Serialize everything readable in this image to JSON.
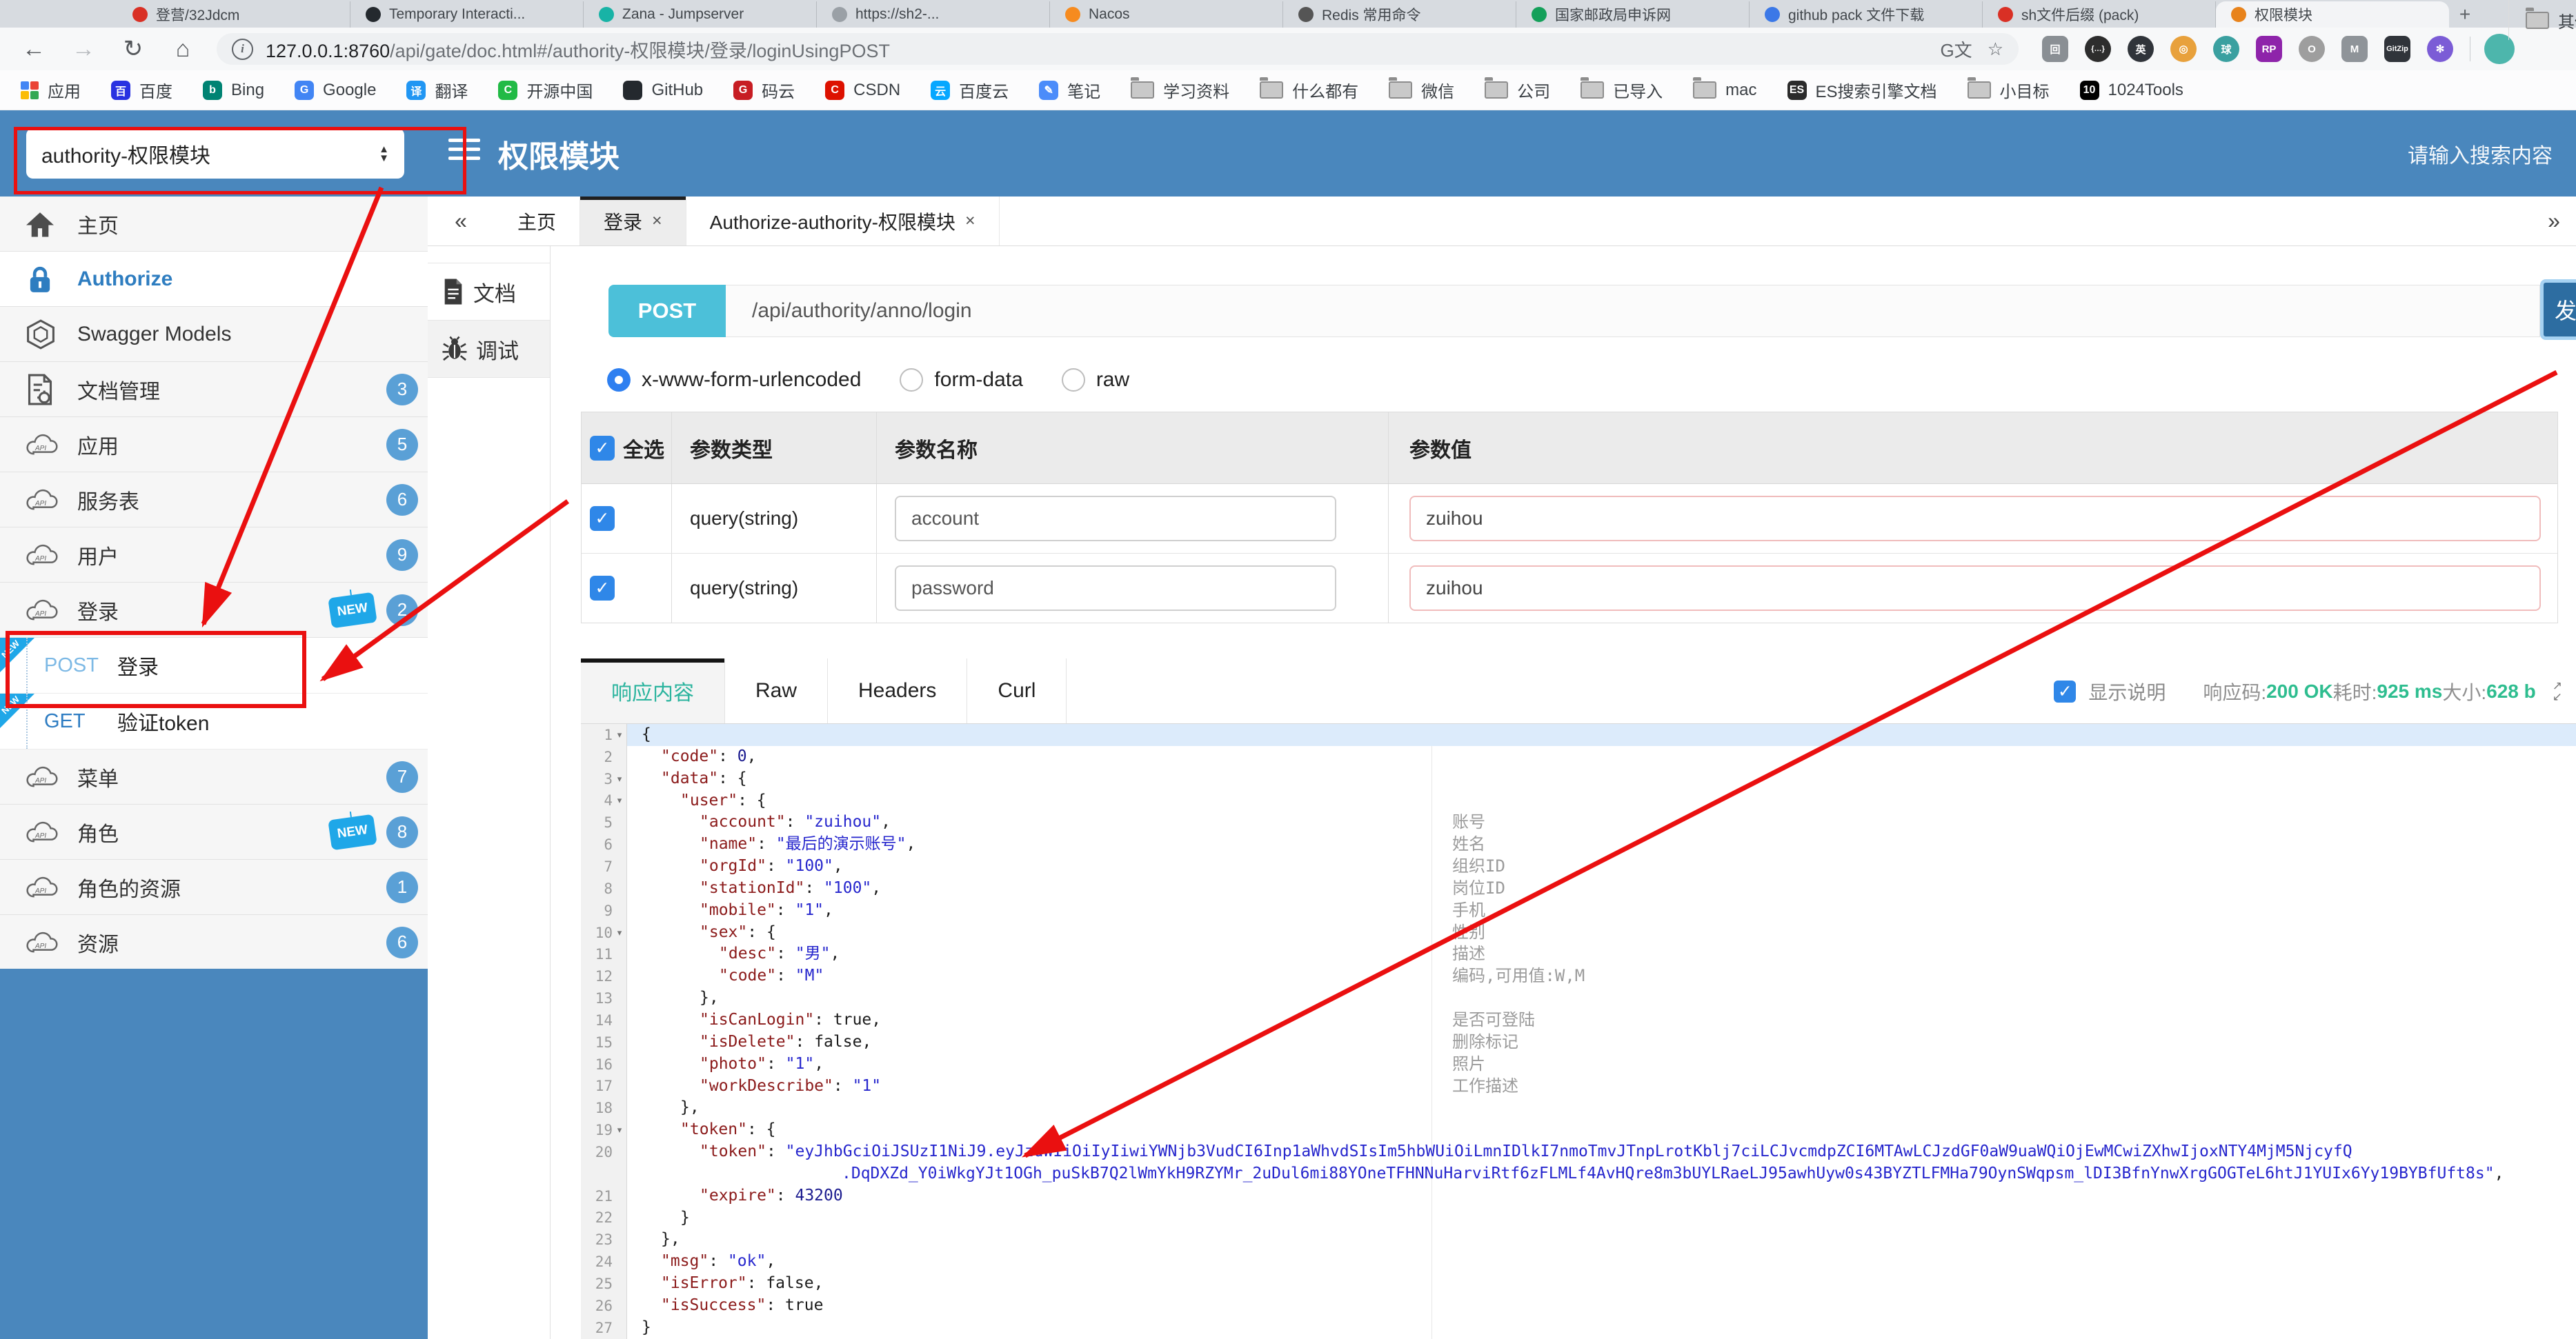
{
  "colors": {
    "header_blue": "#4a87bd",
    "annotation_red": "#ea1010",
    "badge_blue": "#5aa0d6",
    "new_tag_blue": "#1fa7e8",
    "post_chip": "#4cc0d9",
    "send_button": "#2d6da1",
    "response_active_teal": "#2bb49e",
    "status_green": "#2ebd8f",
    "json_key": "#8b1a1a",
    "json_string": "#2626cd",
    "json_number": "#1b1b8f"
  },
  "browser": {
    "tabs": [
      {
        "color": "#d93025",
        "label": "登营/32Jdcm"
      },
      {
        "color": "#24292e",
        "label": "Temporary Interacti..."
      },
      {
        "color": "#18b3a6",
        "label": "Zana - Jumpserver"
      },
      {
        "color": "#9aa0a6",
        "label": "https://sh2-..."
      },
      {
        "color": "#f68b1f",
        "label": "Nacos"
      },
      {
        "color": "#555555",
        "label": "Redis 常用命令"
      },
      {
        "color": "#14a05a",
        "label": "国家邮政局申诉网"
      },
      {
        "color": "#3b78e7",
        "label": "github pack 文件下载"
      },
      {
        "color": "#d93025",
        "label": "sh文件后缀 (pack)"
      },
      {
        "color": "#e8831c",
        "label": "权限模块",
        "active": true
      }
    ],
    "new_tab_glyph": "+",
    "url_host": "127.0.0.1:8760",
    "url_rest": "/api/gate/doc.html#/authority-权限模块/登录/loginUsingPOST",
    "ext_icons": [
      {
        "glyph": "回",
        "color": "#8a8f94",
        "shape": "square"
      },
      {
        "glyph": "{…}",
        "color": "#2d2d2d",
        "shape": "circle"
      },
      {
        "glyph": "英",
        "color": "#30343a",
        "shape": "circle"
      },
      {
        "glyph": "◎",
        "color": "#e8a13c",
        "shape": "circle"
      },
      {
        "glyph": "球",
        "color": "#3aa0a0",
        "shape": "circle"
      },
      {
        "glyph": "RP",
        "color": "#8e24aa",
        "shape": "square"
      },
      {
        "glyph": "O",
        "color": "#9e9e9e",
        "shape": "circle"
      },
      {
        "glyph": "M",
        "color": "#8f9499",
        "shape": "square"
      },
      {
        "glyph": "GitZip",
        "color": "#30343a",
        "shape": "square"
      },
      {
        "glyph": "✻",
        "color": "#7b5cd6",
        "shape": "circle"
      }
    ],
    "bookmarks": [
      {
        "kind": "grid",
        "label": "应用"
      },
      {
        "kind": "site",
        "color": "#2932e1",
        "glyph": "百",
        "label": "百度"
      },
      {
        "kind": "site",
        "color": "#008373",
        "glyph": "b",
        "label": "Bing"
      },
      {
        "kind": "site",
        "color": "#4285f4",
        "glyph": "G",
        "label": "Google"
      },
      {
        "kind": "site",
        "color": "#2196f3",
        "glyph": "译",
        "label": "翻译"
      },
      {
        "kind": "site",
        "color": "#21ba45",
        "glyph": "C",
        "label": "开源中国"
      },
      {
        "kind": "site",
        "color": "#24292e",
        "glyph": "",
        "label": "GitHub"
      },
      {
        "kind": "site",
        "color": "#c71d23",
        "glyph": "G",
        "label": "码云"
      },
      {
        "kind": "site",
        "color": "#dd1100",
        "glyph": "C",
        "label": "CSDN"
      },
      {
        "kind": "site",
        "color": "#06a7ff",
        "glyph": "云",
        "label": "百度云"
      },
      {
        "kind": "site",
        "color": "#4b8cfa",
        "glyph": "✎",
        "label": "笔记"
      },
      {
        "kind": "folder",
        "label": "学习资料"
      },
      {
        "kind": "folder",
        "label": "什么都有"
      },
      {
        "kind": "folder",
        "label": "微信"
      },
      {
        "kind": "folder",
        "label": "公司"
      },
      {
        "kind": "folder",
        "label": "已导入"
      },
      {
        "kind": "folder",
        "label": "mac"
      },
      {
        "kind": "site",
        "color": "#2b2b2b",
        "glyph": "ES",
        "label": "ES搜索引擎文档"
      },
      {
        "kind": "folder",
        "label": "小目标"
      },
      {
        "kind": "site",
        "color": "#000000",
        "glyph": "10",
        "label": "1024Tools"
      }
    ],
    "other_bookmarks_label": "其他书签"
  },
  "header": {
    "module_select_value": "authority-权限模块",
    "title": "权限模块",
    "search_placeholder": "请输入搜索内容"
  },
  "sidebar": {
    "items": [
      {
        "icon": "home",
        "label": "主页"
      },
      {
        "icon": "lock",
        "label": "Authorize",
        "active": true
      },
      {
        "icon": "hexagon",
        "label": "Swagger Models"
      },
      {
        "icon": "doc-gear",
        "label": "文档管理",
        "badge": "3"
      },
      {
        "icon": "cloud-api",
        "label": "应用",
        "badge": "5"
      },
      {
        "icon": "cloud-api",
        "label": "服务表",
        "badge": "6"
      },
      {
        "icon": "cloud-api",
        "label": "用户",
        "badge": "9"
      },
      {
        "icon": "cloud-api",
        "label": "登录",
        "badge": "2",
        "new_tag": true
      },
      {
        "method": "POST",
        "label": "登录",
        "new_corner": true
      },
      {
        "method": "GET",
        "label": "验证token",
        "new_corner": true
      },
      {
        "icon": "cloud-api",
        "label": "菜单",
        "badge": "7"
      },
      {
        "icon": "cloud-api",
        "label": "角色",
        "badge": "8",
        "new_tag": true
      },
      {
        "icon": "cloud-api",
        "label": "角色的资源",
        "badge": "1"
      },
      {
        "icon": "cloud-api",
        "label": "资源",
        "badge": "6"
      }
    ]
  },
  "page_tabs": {
    "collapse_glyph": "«",
    "expand_glyph": "»",
    "tabs": [
      {
        "label": "主页"
      },
      {
        "label": "登录",
        "close": true,
        "active": true
      },
      {
        "label": "Authorize-authority-权限模块",
        "close": true
      }
    ]
  },
  "doc_tabs": [
    {
      "icon": "doc",
      "label": "文档"
    },
    {
      "icon": "bug",
      "label": "调试",
      "active": true
    }
  ],
  "request": {
    "method": "POST",
    "path": "/api/authority/anno/login",
    "send_label": "发送",
    "content_types": [
      "x-www-form-urlencoded",
      "form-data",
      "raw"
    ],
    "selected_content_type": "x-www-form-urlencoded"
  },
  "params": {
    "select_all_label": "全选",
    "columns": {
      "type": "参数类型",
      "name": "参数名称",
      "value": "参数值"
    },
    "rows": [
      {
        "checked": true,
        "type": "query(string)",
        "name": "account",
        "value": "zuihou"
      },
      {
        "checked": true,
        "type": "query(string)",
        "name": "password",
        "value": "zuihou"
      }
    ]
  },
  "response": {
    "tabs": [
      "响应内容",
      "Raw",
      "Headers",
      "Curl"
    ],
    "active_tab": "响应内容",
    "show_desc_checked": true,
    "show_desc_label": "显示说明",
    "status": [
      [
        "响应码:",
        "gray"
      ],
      [
        "200 OK",
        "green"
      ],
      [
        "耗时:",
        "gray"
      ],
      [
        "925 ms",
        "green"
      ],
      [
        "大小:",
        "gray"
      ],
      [
        "628 b",
        "green"
      ]
    ]
  },
  "json_view": {
    "lines": [
      {
        "n": 1,
        "i": 0,
        "f": true,
        "s": [
          [
            "p",
            "{"
          ]
        ]
      },
      {
        "n": 2,
        "i": 1,
        "s": [
          [
            "k",
            "\"code\""
          ],
          [
            "p",
            ": "
          ],
          [
            "n",
            "0"
          ],
          [
            "p",
            ","
          ]
        ]
      },
      {
        "n": 3,
        "i": 1,
        "f": true,
        "s": [
          [
            "k",
            "\"data\""
          ],
          [
            "p",
            ": "
          ],
          [
            "p",
            "{"
          ]
        ]
      },
      {
        "n": 4,
        "i": 2,
        "f": true,
        "s": [
          [
            "k",
            "\"user\""
          ],
          [
            "p",
            ": "
          ],
          [
            "p",
            "{"
          ]
        ]
      },
      {
        "n": 5,
        "i": 3,
        "note": "账号",
        "s": [
          [
            "k",
            "\"account\""
          ],
          [
            "p",
            ": "
          ],
          [
            "s",
            "\"zuihou\""
          ],
          [
            "p",
            ","
          ]
        ]
      },
      {
        "n": 6,
        "i": 3,
        "note": "姓名",
        "s": [
          [
            "k",
            "\"name\""
          ],
          [
            "p",
            ": "
          ],
          [
            "s",
            "\"最后的演示账号\""
          ],
          [
            "p",
            ","
          ]
        ]
      },
      {
        "n": 7,
        "i": 3,
        "note": "组织ID",
        "s": [
          [
            "k",
            "\"orgId\""
          ],
          [
            "p",
            ": "
          ],
          [
            "s",
            "\"100\""
          ],
          [
            "p",
            ","
          ]
        ]
      },
      {
        "n": 8,
        "i": 3,
        "note": "岗位ID",
        "s": [
          [
            "k",
            "\"stationId\""
          ],
          [
            "p",
            ": "
          ],
          [
            "s",
            "\"100\""
          ],
          [
            "p",
            ","
          ]
        ]
      },
      {
        "n": 9,
        "i": 3,
        "note": "手机",
        "s": [
          [
            "k",
            "\"mobile\""
          ],
          [
            "p",
            ": "
          ],
          [
            "s",
            "\"1\""
          ],
          [
            "p",
            ","
          ]
        ]
      },
      {
        "n": 10,
        "i": 3,
        "f": true,
        "note": "性别",
        "s": [
          [
            "k",
            "\"sex\""
          ],
          [
            "p",
            ": "
          ],
          [
            "p",
            "{"
          ]
        ]
      },
      {
        "n": 11,
        "i": 4,
        "note": "描述",
        "s": [
          [
            "k",
            "\"desc\""
          ],
          [
            "p",
            ": "
          ],
          [
            "s",
            "\"男\""
          ],
          [
            "p",
            ","
          ]
        ]
      },
      {
        "n": 12,
        "i": 4,
        "note": "编码,可用值:W,M",
        "s": [
          [
            "k",
            "\"code\""
          ],
          [
            "p",
            ": "
          ],
          [
            "s",
            "\"M\""
          ]
        ]
      },
      {
        "n": 13,
        "i": 3,
        "s": [
          [
            "p",
            "},"
          ]
        ]
      },
      {
        "n": 14,
        "i": 3,
        "note": "是否可登陆",
        "s": [
          [
            "k",
            "\"isCanLogin\""
          ],
          [
            "p",
            ": "
          ],
          [
            "b",
            "true"
          ],
          [
            "p",
            ","
          ]
        ]
      },
      {
        "n": 15,
        "i": 3,
        "note": "删除标记",
        "s": [
          [
            "k",
            "\"isDelete\""
          ],
          [
            "p",
            ": "
          ],
          [
            "b",
            "false"
          ],
          [
            "p",
            ","
          ]
        ]
      },
      {
        "n": 16,
        "i": 3,
        "note": "照片",
        "s": [
          [
            "k",
            "\"photo\""
          ],
          [
            "p",
            ": "
          ],
          [
            "s",
            "\"1\""
          ],
          [
            "p",
            ","
          ]
        ]
      },
      {
        "n": 17,
        "i": 3,
        "note": "工作描述",
        "s": [
          [
            "k",
            "\"workDescribe\""
          ],
          [
            "p",
            ": "
          ],
          [
            "s",
            "\"1\""
          ]
        ]
      },
      {
        "n": 18,
        "i": 2,
        "s": [
          [
            "p",
            "},"
          ]
        ]
      },
      {
        "n": 19,
        "i": 2,
        "f": true,
        "s": [
          [
            "k",
            "\"token\""
          ],
          [
            "p",
            ": "
          ],
          [
            "p",
            "{"
          ]
        ]
      },
      {
        "n": 20,
        "i": 3,
        "s": [
          [
            "k",
            "\"token\""
          ],
          [
            "p",
            ": "
          ],
          [
            "s",
            "\"eyJhbGciOiJSUzI1NiJ9.eyJzdWIiOiIyIiwiYWNjb3VudCI6Inp1aWhvdSIsIm5hbWUiOiLmnIDlkI7nmoTmvJTnpLrotKblj7ciLCJvcmdpZCI6MTAwLCJzdGF0aW9uaWQiOjEwMCwiZXhwIjoxNTY4MjM5NjcyfQ"
          ]
        ],
        "cont": [
          [
            "s",
            ".DqDXZd_Y0iWkgYJt1OGh_puSkB7Q2lWmYkH9RZYMr_2uDul6mi88YOneTFHNNuHarviRtf6zFLMLf4AvHQre8m3bUYLRaeLJ95awhUyw0s43BYZTLFMHa79OynSWqpsm_lDI3BfnYnwXrgGOGTeL6htJ1YUIx6Yy19BYBfUft8s\""
          ],
          [
            "p",
            ","
          ]
        ]
      },
      {
        "n": 21,
        "i": 3,
        "s": [
          [
            "k",
            "\"expire\""
          ],
          [
            "p",
            ": "
          ],
          [
            "n",
            "43200"
          ]
        ]
      },
      {
        "n": 22,
        "i": 2,
        "s": [
          [
            "p",
            "}"
          ]
        ]
      },
      {
        "n": 23,
        "i": 1,
        "s": [
          [
            "p",
            "},"
          ]
        ]
      },
      {
        "n": 24,
        "i": 1,
        "s": [
          [
            "k",
            "\"msg\""
          ],
          [
            "p",
            ": "
          ],
          [
            "s",
            "\"ok\""
          ],
          [
            "p",
            ","
          ]
        ]
      },
      {
        "n": 25,
        "i": 1,
        "s": [
          [
            "k",
            "\"isError\""
          ],
          [
            "p",
            ": "
          ],
          [
            "b",
            "false"
          ],
          [
            "p",
            ","
          ]
        ]
      },
      {
        "n": 26,
        "i": 1,
        "s": [
          [
            "k",
            "\"isSuccess\""
          ],
          [
            "p",
            ": "
          ],
          [
            "b",
            "true"
          ]
        ]
      },
      {
        "n": 27,
        "i": 0,
        "s": [
          [
            "p",
            "}"
          ]
        ]
      }
    ]
  }
}
